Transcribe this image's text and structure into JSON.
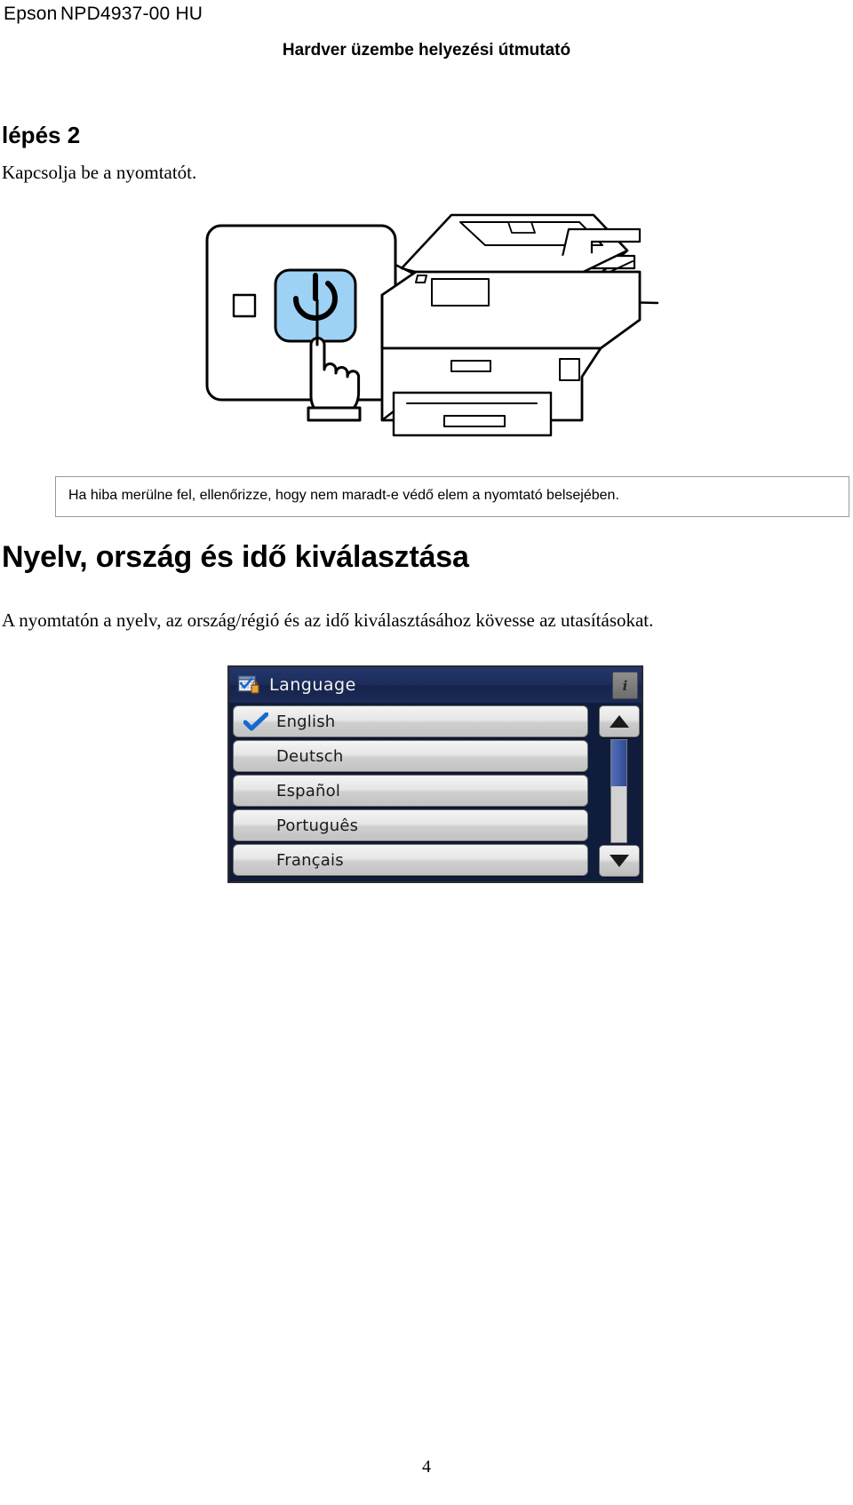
{
  "header": {
    "brand": "Epson",
    "doc_code": "NPD4937-00 HU",
    "title": "Hardver üzembe helyezési útmutató"
  },
  "step": {
    "label": "lépés 2",
    "instruction": "Kapcsolja be a nyomtatót."
  },
  "illustration": {
    "callout_name": "power-button-callout",
    "power_button_color": "#9ed2f5",
    "printer_name": "epson-multifunction-printer"
  },
  "note": {
    "text": "Ha hiba merülne fel, ellenőrizze, hogy nem maradt-e védő elem a nyomtató belsejében.",
    "border_color": "#9a9a9a"
  },
  "section": {
    "heading": "Nyelv, ország és idő kiválasztása",
    "body": "A nyomtatón a nyelv, az ország/régió és az idő kiválasztásához kövesse az utasításokat."
  },
  "lcd": {
    "title": "Language",
    "title_icon": "language-settings-icon",
    "info_button": "i",
    "background_color": "#0f1c3c",
    "titlebar_color": "#1e2f5e",
    "check_color": "#1469d2",
    "scroll_up": "▲",
    "scroll_down": "▼",
    "items": [
      {
        "label": "English",
        "selected": true
      },
      {
        "label": "Deutsch",
        "selected": false
      },
      {
        "label": "Español",
        "selected": false
      },
      {
        "label": "Português",
        "selected": false
      },
      {
        "label": "Français",
        "selected": false
      }
    ]
  },
  "footer": {
    "page_number": "4"
  }
}
